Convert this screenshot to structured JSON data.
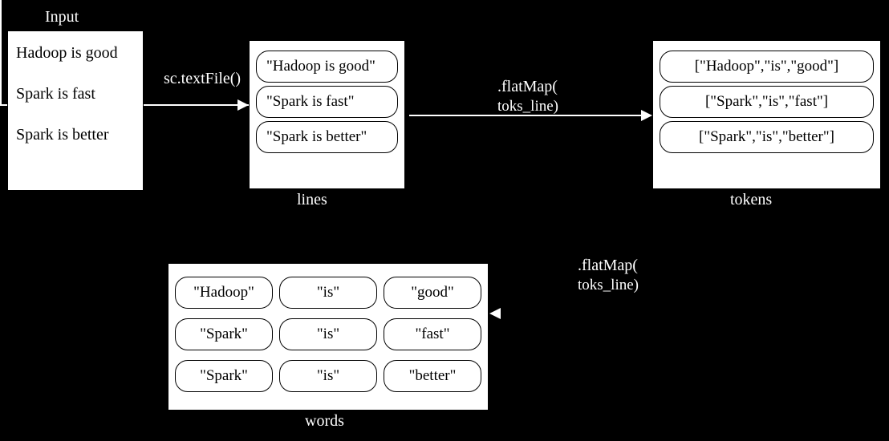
{
  "input": {
    "title": "Input",
    "lines": [
      "Hadoop is good",
      "Spark is fast",
      "Spark is better"
    ]
  },
  "textFileLabel": "sc.textFile()",
  "linesRdd": {
    "name": "lines",
    "items": [
      "\"Hadoop is good\"",
      "\"Spark is fast\"",
      "\"Spark is better\""
    ]
  },
  "flatMap1": {
    "op": ".flatMap(",
    "fn": "toks_line)"
  },
  "tokensRdd": {
    "name": "tokens",
    "items": [
      "[\"Hadoop\",\"is\",\"good\"]",
      "[\"Spark\",\"is\",\"fast\"]",
      "[\"Spark\",\"is\",\"better\"]"
    ]
  },
  "flatMap2": {
    "op": ".flatMap(",
    "fn": "toks_line)"
  },
  "wordsRdd": {
    "name": "words",
    "rows": [
      [
        "\"Hadoop\"",
        "\"is\"",
        "\"good\""
      ],
      [
        "\"Spark\"",
        "\"is\"",
        "\"fast\""
      ],
      [
        "\"Spark\"",
        "\"is\"",
        "\"better\""
      ]
    ]
  }
}
